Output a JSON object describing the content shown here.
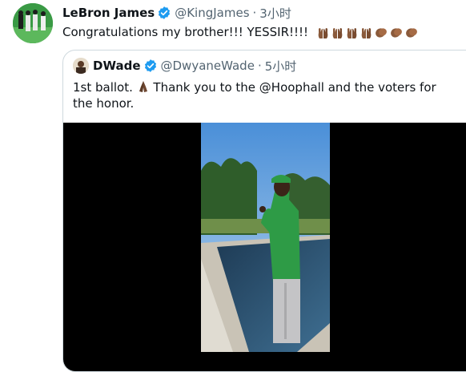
{
  "tweet": {
    "author_name": "LeBron James",
    "handle": "@KingJames",
    "separator": "·",
    "time": "3小时",
    "text": "Congratulations my brother!!! YESSIR!!!!"
  },
  "quote": {
    "author_name": "DWade",
    "handle": "@DwyaneWade",
    "separator": "·",
    "time": "5小时",
    "text_before_emoji": "1st ballot. ",
    "text_after_emoji": " Thank you to the @Hoophall and the voters for the honor."
  },
  "colors": {
    "verified": "#1d9bf0",
    "text_primary": "#0f1419",
    "text_secondary": "#536471",
    "border": "#cfd9de",
    "skin_emoji": "#8a5a3b"
  },
  "icons": {
    "verified": "verified-badge-icon",
    "raised_hands": "raised-hands-emoji",
    "clapping": "clapping-hands-emoji",
    "praying": "folded-hands-emoji"
  }
}
